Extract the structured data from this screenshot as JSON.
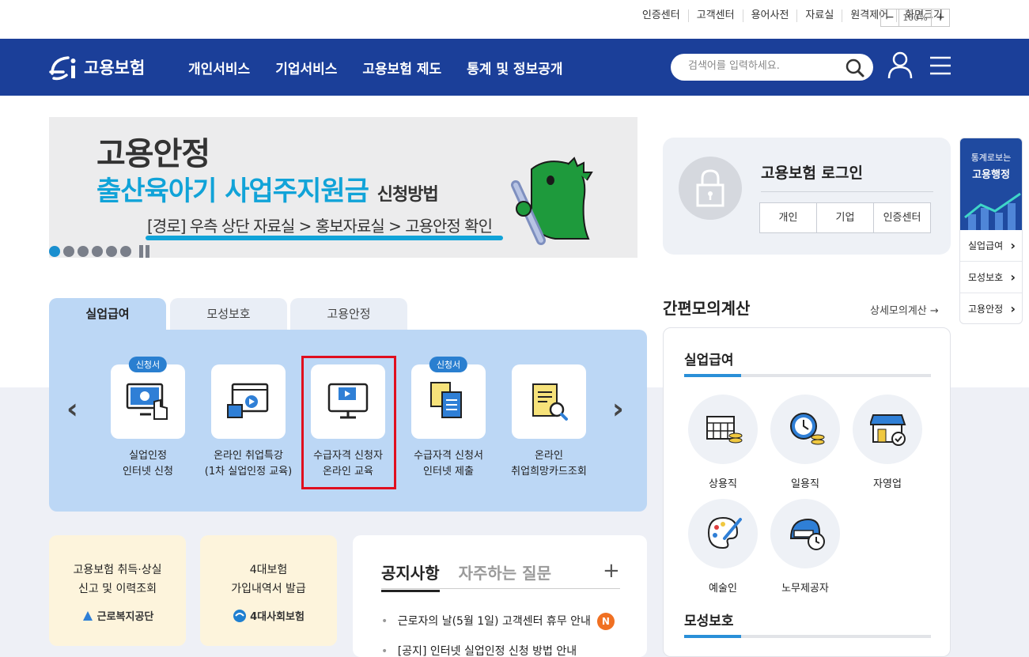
{
  "util_links": [
    "인증센터",
    "고객센터",
    "용어사전",
    "자료실",
    "원격제어",
    "화면크기"
  ],
  "zoom": {
    "minus": "−",
    "value": "100%",
    "plus": "+"
  },
  "header": {
    "logo_text": "고용보험",
    "nav": [
      "개인서비스",
      "기업서비스",
      "고용보험 제도",
      "통계 및 정보공개"
    ],
    "search_placeholder": "검색어를 입력하세요."
  },
  "banner": {
    "line1": "고용안정",
    "line2": "출산육아기 사업주지원금",
    "line2_suffix": "신청방법",
    "line3": "[경로] 우측 상단 자료실 > 홍보자료실 > 고용안정 확인",
    "slide_count": 6,
    "active_slide": 1
  },
  "tabs": [
    "실업급여",
    "모성보호",
    "고용안정"
  ],
  "services": [
    {
      "label": "실업인정\n인터넷 신청",
      "badge": "신청서",
      "icon": "monitor-click-icon"
    },
    {
      "label": "온라인 취업특강\n(1차 실업인정 교육)",
      "badge": "",
      "icon": "video-window-icon"
    },
    {
      "label": "수급자격 신청자\n온라인 교육",
      "badge": "",
      "icon": "monitor-play-icon"
    },
    {
      "label": "수급자격 신청서\n인터넷 제출",
      "badge": "신청서",
      "icon": "documents-icon"
    },
    {
      "label": "온라인\n취업희망카드조회",
      "badge": "",
      "icon": "card-search-icon"
    }
  ],
  "quick_cards": [
    {
      "title": "고용보험 취득·상실\n신고 및 이력조회",
      "org": "근로복지공단"
    },
    {
      "title": "4대보험\n가입내역서 발급",
      "org": "4대사회보험"
    }
  ],
  "notice": {
    "tab_active": "공지사항",
    "tab_inactive": "자주하는 질문",
    "plus": "+",
    "items": [
      {
        "text": "근로자의 날(5월 1일) 고객센터 휴무 안내",
        "badge": "N"
      },
      {
        "text": "[공지] 인터넷 실업인정 신청 방법 안내",
        "badge": ""
      }
    ]
  },
  "login": {
    "title": "고용보험 로그인",
    "buttons": [
      "개인",
      "기업",
      "인증센터"
    ]
  },
  "calc": {
    "title": "간편모의계산",
    "more": "상세모의계산 →",
    "section1": "실업급여",
    "items": [
      {
        "label": "상용직",
        "icon": "calendar-coins-icon"
      },
      {
        "label": "일용직",
        "icon": "clock-coins-icon"
      },
      {
        "label": "자영업",
        "icon": "store-icon"
      },
      {
        "label": "예술인",
        "icon": "palette-icon"
      },
      {
        "label": "노무제공자",
        "icon": "helmet-clock-icon"
      }
    ],
    "section2": "모성보호"
  },
  "side": {
    "top_small": "통계로보는",
    "top_big": "고용행정",
    "items": [
      "실업급여",
      "모성보호",
      "고용안정"
    ]
  },
  "colors": {
    "header": "#1b3f99",
    "panel": "#bcd7f5",
    "accent": "#11a3d8",
    "highlight": "#e00e1e"
  }
}
